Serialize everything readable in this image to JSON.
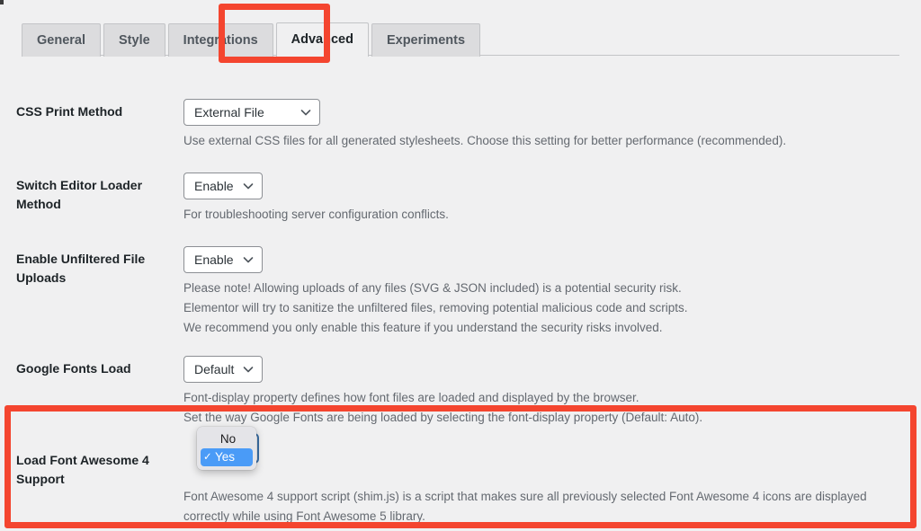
{
  "page": {
    "background_color": "#f0f0f1",
    "annotation_color": "#f4452f"
  },
  "tabs": [
    {
      "label": "General",
      "active": false
    },
    {
      "label": "Style",
      "active": false
    },
    {
      "label": "Integrations",
      "active": false
    },
    {
      "label": "Advanced",
      "active": true
    },
    {
      "label": "Experiments",
      "active": false
    }
  ],
  "settings": [
    {
      "id": "css-print-method",
      "label": "CSS Print Method",
      "select_value": "External File",
      "descriptions": [
        "Use external CSS files for all generated stylesheets. Choose this setting for better performance (recommended)."
      ]
    },
    {
      "id": "switch-editor-loader-method",
      "label": "Switch Editor Loader Method",
      "select_value": "Enable",
      "descriptions": [
        "For troubleshooting server configuration conflicts."
      ]
    },
    {
      "id": "enable-unfiltered-file-uploads",
      "label": "Enable Unfiltered File Uploads",
      "select_value": "Enable",
      "descriptions": [
        "Please note! Allowing uploads of any files (SVG & JSON included) is a potential security risk.",
        "Elementor will try to sanitize the unfiltered files, removing potential malicious code and scripts.",
        "We recommend you only enable this feature if you understand the security risks involved."
      ]
    },
    {
      "id": "google-fonts-load",
      "label": "Google Fonts Load",
      "select_value": "Default",
      "descriptions": [
        "Font-display property defines how font files are loaded and displayed by the browser.",
        "Set the way Google Fonts are being loaded by selecting the font-display property (Default: Auto)."
      ]
    },
    {
      "id": "load-font-awesome-4-support",
      "label": "Load Font Awesome 4 Support",
      "select_value": "Yes",
      "descriptions": [
        "Font Awesome 4 support script (shim.js) is a script that makes sure all previously selected Font Awesome 4 icons are displayed",
        "correctly while using Font Awesome 5 library."
      ]
    }
  ],
  "open_dropdown": {
    "for_setting": "load-font-awesome-4-support",
    "options": [
      {
        "label": "No",
        "selected": false,
        "check": ""
      },
      {
        "label": "Yes",
        "selected": true,
        "check": "✓"
      }
    ],
    "highlight_color": "#4a9bf7"
  },
  "annotations": [
    {
      "id": "advanced-tab",
      "target": "Advanced tab"
    },
    {
      "id": "fontawesome-row",
      "target": "Load Font Awesome 4 Support"
    }
  ]
}
